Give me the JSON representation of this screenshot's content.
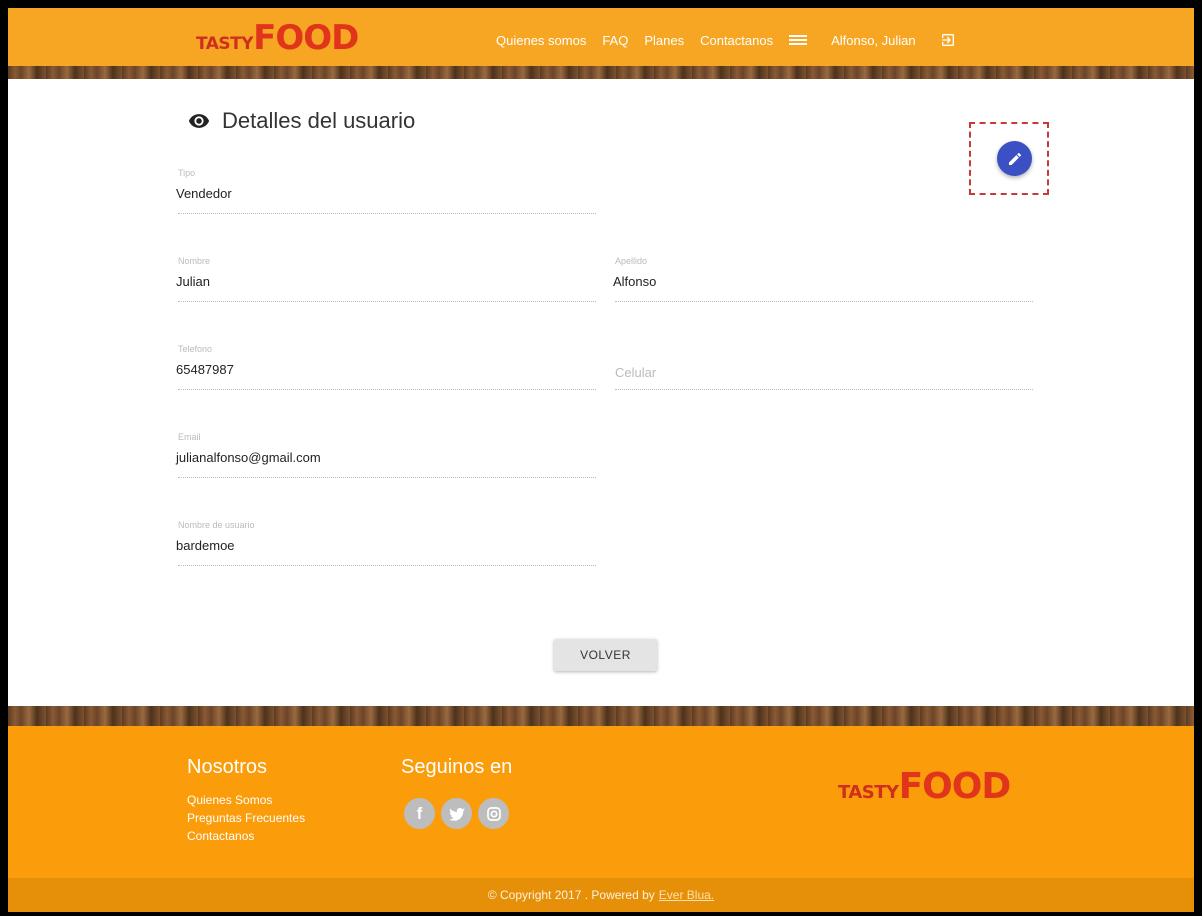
{
  "brand": {
    "tasty": "TASTY",
    "food": "FOOD"
  },
  "nav": {
    "links": [
      "Quienes somos",
      "FAQ",
      "Planes",
      "Contactanos"
    ],
    "user_name": "Alfonso, Julian"
  },
  "page": {
    "title": "Detalles del usuario",
    "eye_icon": "eye-icon"
  },
  "fields": {
    "tipo": {
      "label": "Tipo",
      "value": "Vendedor"
    },
    "nombre": {
      "label": "Nombre",
      "value": "Julian"
    },
    "apellido": {
      "label": "Apellido",
      "value": "Alfonso"
    },
    "telefono": {
      "label": "Telefono",
      "value": "65487987"
    },
    "celular": {
      "placeholder": "Celular"
    },
    "email": {
      "label": "Email",
      "value": "julianalfonso@gmail.com"
    },
    "usuario": {
      "label": "Nombre de usuario",
      "value": "bardemoe"
    }
  },
  "actions": {
    "back_label": "VOLVER"
  },
  "footer": {
    "nosotros_title": "Nosotros",
    "links": [
      "Quienes Somos",
      "Preguntas Frecuentes",
      "Contactanos"
    ],
    "social_title": "Seguinos en",
    "social": {
      "facebook": "f",
      "twitter": "t",
      "instagram": "ig"
    },
    "copyright": "© Copyright 2017 . Powered by",
    "powered_by": "Ever Blua."
  },
  "colors": {
    "header": "#f6a623",
    "footer": "#fb9c0a",
    "accent": "#3b50c2"
  }
}
